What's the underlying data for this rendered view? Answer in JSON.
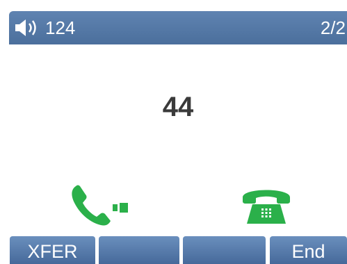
{
  "status_bar": {
    "line_label": "124",
    "page_indicator": "2/2"
  },
  "call": {
    "caller_number": "44",
    "call_status_icon": "outgoing-call-icon",
    "phone_icon": "desk-phone-icon"
  },
  "softkeys": [
    {
      "label": "XFER"
    },
    {
      "label": ""
    },
    {
      "label": ""
    },
    {
      "label": "End"
    }
  ],
  "colors": {
    "status_bar": "#4b6f9c",
    "softkey": "#5a7eab",
    "icon_green": "#2bb04a",
    "text_dark": "#3a3a3a"
  }
}
